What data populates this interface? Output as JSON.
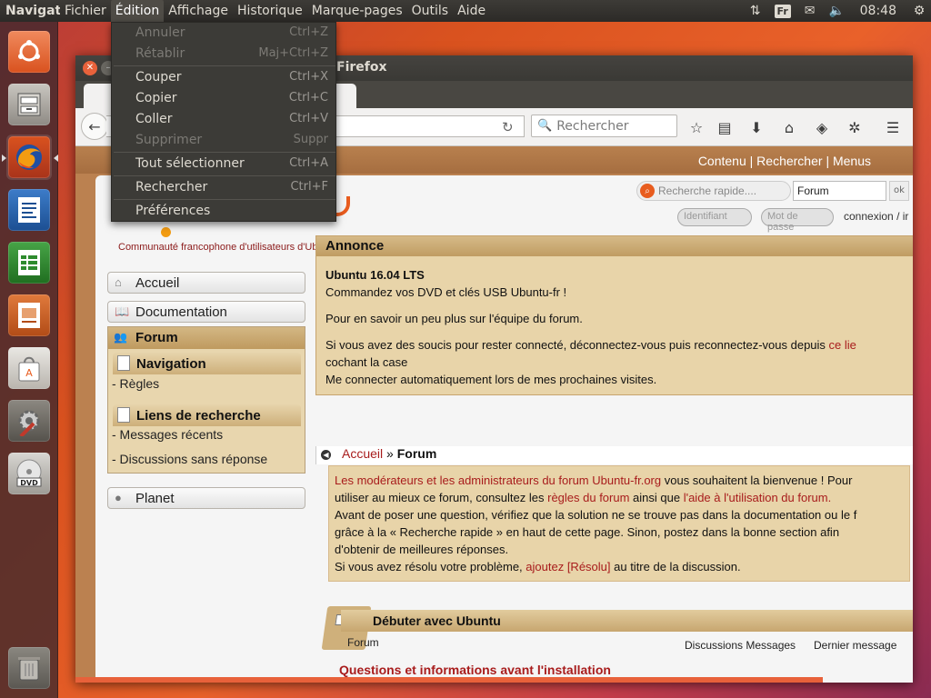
{
  "top_panel": {
    "app_name": "Navigateur web Firefox",
    "menus": [
      "Fichier",
      "Édition",
      "Affichage",
      "Historique",
      "Marque-pages",
      "Outils",
      "Aide"
    ],
    "keyboard_layout": "Fr",
    "clock": "08:48"
  },
  "launcher": {
    "items": [
      "ubuntu-dash",
      "files",
      "firefox",
      "libreoffice-writer",
      "libreoffice-calc",
      "libreoffice-impress",
      "ubuntu-software",
      "system-settings",
      "dvd",
      "trash"
    ]
  },
  "edit_menu": {
    "items": [
      {
        "label": "Annuler",
        "shortcut": "Ctrl+Z",
        "enabled": false
      },
      {
        "label": "Rétablir",
        "shortcut": "Maj+Ctrl+Z",
        "enabled": false
      },
      {
        "label": "Couper",
        "shortcut": "Ctrl+X",
        "enabled": true
      },
      {
        "label": "Copier",
        "shortcut": "Ctrl+C",
        "enabled": true
      },
      {
        "label": "Coller",
        "shortcut": "Ctrl+V",
        "enabled": true
      },
      {
        "label": "Supprimer",
        "shortcut": "Suppr",
        "enabled": false
      },
      {
        "label": "Tout sélectionner",
        "shortcut": "Ctrl+A",
        "enabled": true
      },
      {
        "label": "Rechercher",
        "shortcut": "Ctrl+F",
        "enabled": true
      },
      {
        "label": "Préférences",
        "shortcut": "",
        "enabled": true
      }
    ]
  },
  "firefox": {
    "window_title": "Firefox",
    "search_placeholder": "Rechercher"
  },
  "page": {
    "header_links": [
      "Contenu",
      "Rechercher",
      "Menus"
    ],
    "header_sep": "|",
    "quick_search_placeholder": "Recherche rapide....",
    "quick_search_scope": "Forum",
    "ok_label": "ok",
    "login_placeholder": "Identifiant",
    "password_placeholder": "Mot de passe",
    "connexion_label": "connexion",
    "connexion_sep": "/",
    "connexion_trunc": "ir",
    "tagline": "Communauté francophone d'utilisateurs d'Ubuntu",
    "sidebar": {
      "accueil": "Accueil",
      "documentation": "Documentation",
      "forum": "Forum",
      "navigation": "Navigation",
      "regles": "- Règles",
      "liens_recherche": "Liens de recherche",
      "messages_recents": "- Messages récents",
      "discussions_sans_reponse": "- Discussions sans réponse",
      "planet": "Planet"
    },
    "annonce": {
      "title": "Annonce",
      "line1": "Ubuntu 16.04 LTS",
      "line2": "Commandez vos DVD et clés USB Ubuntu-fr !",
      "line3": "Pour en savoir un peu plus sur l'équipe du forum.",
      "line4a": "Si vous avez des soucis pour rester connecté, déconnectez-vous puis reconnectez-vous depuis ",
      "line4_link": "ce lie",
      "line5": "cochant la case",
      "line6": "Me connecter automatiquement lors de mes prochaines visites."
    },
    "breadcrumb": {
      "home": "Accueil",
      "sep": "»",
      "current": "Forum"
    },
    "welcome": {
      "l1_link": "Les modérateurs et les administrateurs du forum Ubuntu-fr.org",
      "l1_text": " vous souhaitent la bienvenue ! Pour",
      "l2a": "utiliser au mieux ce forum, consultez les ",
      "l2_link1": "règles du forum",
      "l2b": " ainsi que ",
      "l2_link2": "l'aide à l'utilisation du forum.",
      "l3": "Avant de poser une question, vérifiez que la solution ne se trouve pas dans la documentation ou le f",
      "l4": "grâce à la « Recherche rapide » en haut de cette page. Sinon, postez dans la bonne section afin",
      "l5": "d'obtenir de meilleures réponses.",
      "l6a": "Si vous avez résolu votre problème, ",
      "l6_link": "ajoutez [Résolu]",
      "l6b": " au titre de la discussion."
    },
    "section": {
      "title": "Débuter avec Ubuntu",
      "col_forum": "Forum",
      "col_stats": "Discussions Messages",
      "col_last": "Dernier message",
      "first_forum": "Questions et informations avant l'installation"
    }
  }
}
